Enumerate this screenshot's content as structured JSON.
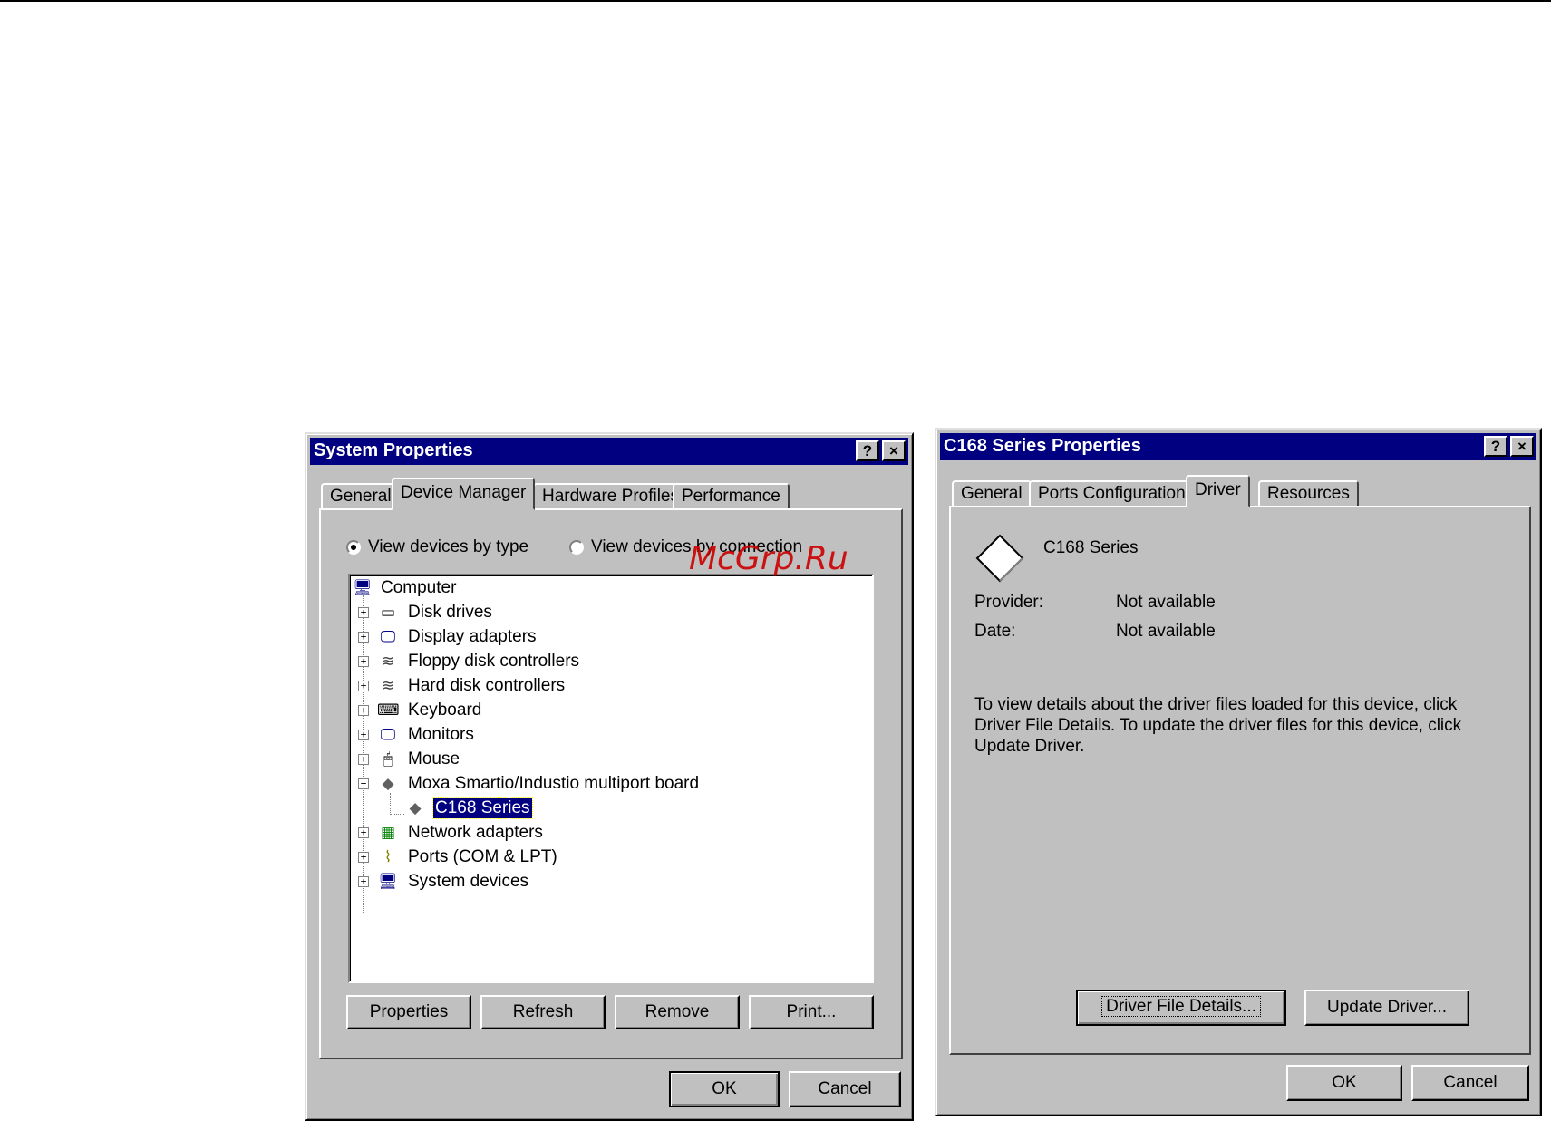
{
  "watermark": "McGrp.Ru",
  "system_properties": {
    "title": "System Properties",
    "help_button": "?",
    "close_button": "×",
    "tabs": [
      "General",
      "Device Manager",
      "Hardware Profiles",
      "Performance"
    ],
    "active_tab": "Device Manager",
    "radio_by_type": "View devices by type",
    "radio_by_connection": "View devices by connection",
    "selected_view": "View devices by type",
    "tree": [
      {
        "label": "Computer",
        "icon": "computer-icon"
      },
      {
        "label": "Disk drives",
        "icon": "disk-drive-icon"
      },
      {
        "label": "Display adapters",
        "icon": "display-adapter-icon"
      },
      {
        "label": "Floppy disk controllers",
        "icon": "floppy-controller-icon"
      },
      {
        "label": "Hard disk controllers",
        "icon": "hard-disk-controller-icon"
      },
      {
        "label": "Keyboard",
        "icon": "keyboard-icon"
      },
      {
        "label": "Monitors",
        "icon": "monitor-icon"
      },
      {
        "label": "Mouse",
        "icon": "mouse-icon"
      },
      {
        "label": "Moxa Smartio/Industio multiport board",
        "icon": "multiport-board-icon"
      },
      {
        "label": "C168 Series",
        "icon": "device-diamond-icon"
      },
      {
        "label": "Network adapters",
        "icon": "network-adapter-icon"
      },
      {
        "label": "Ports (COM & LPT)",
        "icon": "port-icon"
      },
      {
        "label": "System devices",
        "icon": "system-devices-icon"
      }
    ],
    "selected_item": "C168 Series",
    "buttons": {
      "properties": "Properties",
      "refresh": "Refresh",
      "remove": "Remove",
      "print": "Print..."
    },
    "ok": "OK",
    "cancel": "Cancel"
  },
  "c168_properties": {
    "title": "C168 Series Properties",
    "help_button": "?",
    "close_button": "×",
    "tabs": [
      "General",
      "Ports Configuration",
      "Driver",
      "Resources"
    ],
    "active_tab": "Driver",
    "device_name": "C168 Series",
    "provider_label": "Provider:",
    "provider_value": "Not available",
    "date_label": "Date:",
    "date_value": "Not available",
    "description": "To view details about the driver files loaded for this device, click\nDriver File Details.  To update the driver files for this device, click\nUpdate Driver.",
    "driver_file_details": "Driver File Details...",
    "update_driver": "Update Driver...",
    "ok": "OK",
    "cancel": "Cancel"
  }
}
